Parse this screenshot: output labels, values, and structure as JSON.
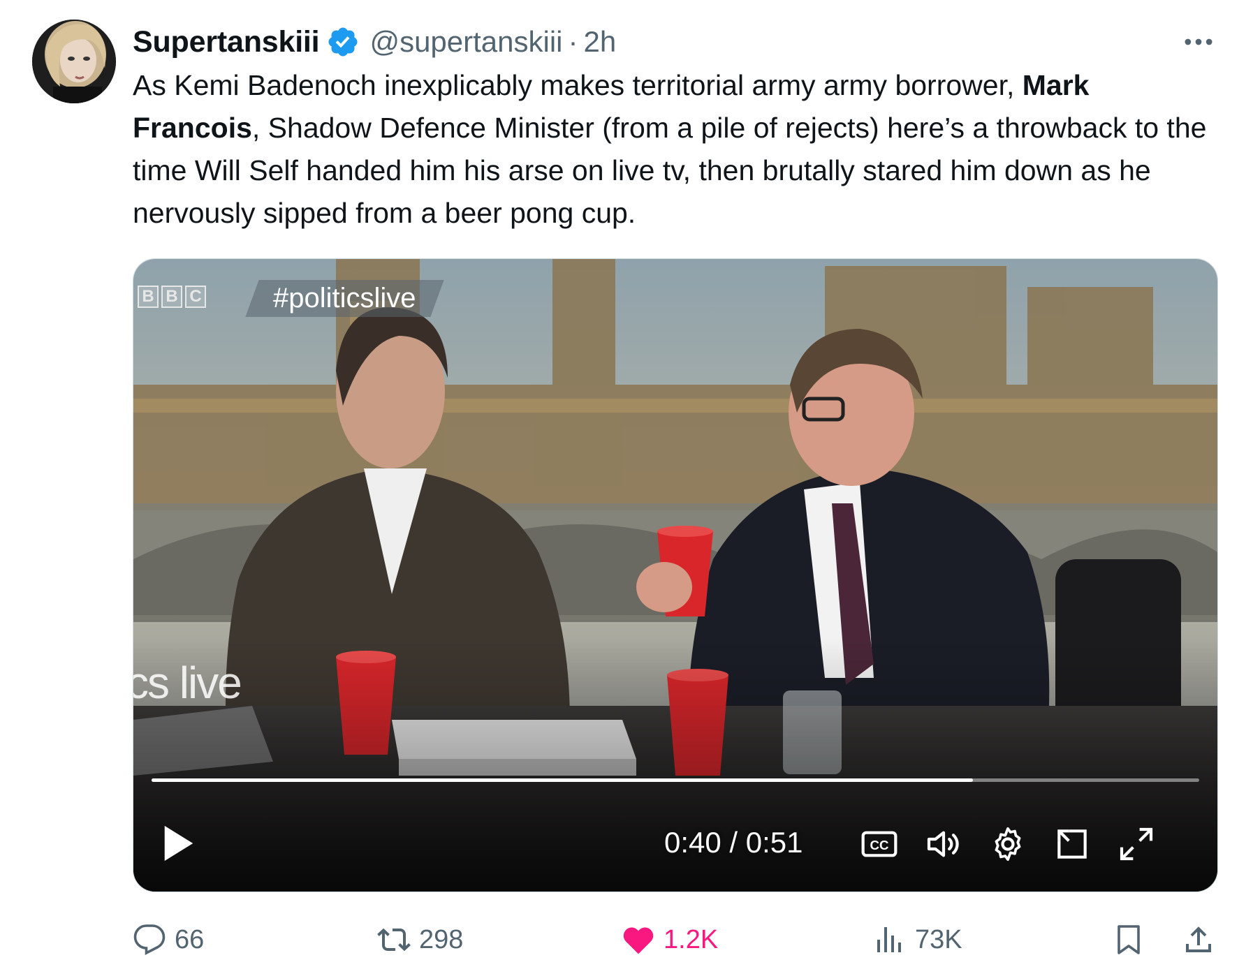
{
  "author": {
    "display_name": "Supertanskiii",
    "handle": "@supertanskiii",
    "separator": "·",
    "time": "2h",
    "verified": true,
    "verified_color": "#1d9bf0"
  },
  "tweet": {
    "text_part1": "As Kemi Badenoch inexplicably makes territorial army army borrower, ",
    "bold1": "Mark Francois",
    "text_part2": ", Shadow Defence Minister (from a pile of rejects) here’s a throwback to the time Will Self handed him his arse on live tv, then brutally stared him down as he nervously sipped from a beer pong cup."
  },
  "video": {
    "overlay_logo_letters": [
      "B",
      "B",
      "C"
    ],
    "overlay_hashtag": "#politicslive",
    "background_text_left": "cs live",
    "current_time": "0:40",
    "time_separator": "/",
    "duration": "0:51",
    "progress_fraction": 0.784,
    "controls": [
      "play-icon",
      "captions-icon",
      "volume-icon",
      "settings-icon",
      "pip-icon",
      "fullscreen-icon"
    ]
  },
  "actions": {
    "replies": "66",
    "reposts": "298",
    "likes": "1.2K",
    "views": "73K",
    "like_color": "#f91880",
    "icon_color": "#536471"
  }
}
